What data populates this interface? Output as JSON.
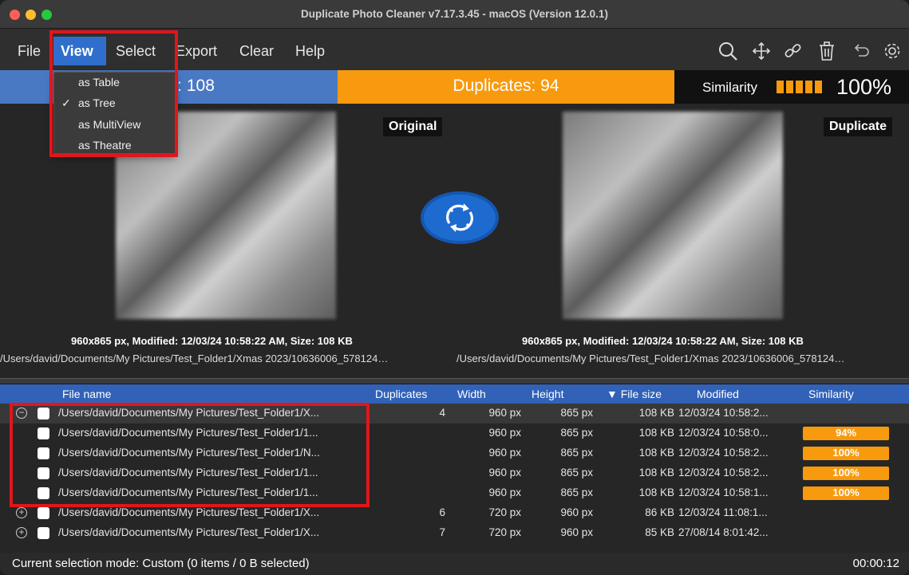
{
  "window": {
    "title": "Duplicate Photo Cleaner v7.17.3.45 - macOS (Version 12.0.1)"
  },
  "menubar": {
    "items": [
      "File",
      "View",
      "Select",
      "Export",
      "Clear",
      "Help"
    ],
    "toolbar_icons": [
      "search-icon",
      "move-icon",
      "link-icon",
      "trash-icon",
      "undo-icon",
      "gear-icon"
    ]
  },
  "view_menu": {
    "items": [
      {
        "label": "as Table",
        "checked": false
      },
      {
        "label": "as Tree",
        "checked": true
      },
      {
        "label": "as MultiView",
        "checked": false
      },
      {
        "label": "as Theatre",
        "checked": false
      }
    ]
  },
  "stats": {
    "files_label": "es: 108",
    "duplicates_label": "Duplicates: 94",
    "similarity_label": "Similarity",
    "similarity_value": "100%",
    "colors": {
      "files": "#4a79c4",
      "duplicates": "#f89a0e",
      "similarity_bg": "#111111"
    }
  },
  "compare": {
    "original_tag": "Original",
    "duplicate_tag": "Duplicate",
    "original_info": "960x865 px, Modified: 12/03/24 10:58:22 AM, Size: 108 KB",
    "duplicate_info": "960x865 px, Modified: 12/03/24 10:58:22 AM, Size: 108 KB",
    "original_path": "/Users/david/Documents/My Pictures/Test_Folder1/Xmas 2023/10636006_578124…",
    "duplicate_path": "/Users/david/Documents/My Pictures/Test_Folder1/Xmas 2023/10636006_578124…"
  },
  "table": {
    "columns": [
      "File name",
      "Duplicates",
      "Width",
      "Height",
      "▼ File size",
      "Modified",
      "Similarity"
    ],
    "rows": [
      {
        "expander": "⊖",
        "fname": "/Users/david/Documents/My Pictures/Test_Folder1/X...",
        "dups": "4",
        "width": "960 px",
        "height": "865 px",
        "fsize": "108 KB",
        "mod": "12/03/24 10:58:2...",
        "sim": ""
      },
      {
        "expander": "",
        "fname": "/Users/david/Documents/My Pictures/Test_Folder1/1...",
        "dups": "",
        "width": "960 px",
        "height": "865 px",
        "fsize": "108 KB",
        "mod": "12/03/24 10:58:0...",
        "sim": "94%"
      },
      {
        "expander": "",
        "fname": "/Users/david/Documents/My Pictures/Test_Folder1/N...",
        "dups": "",
        "width": "960 px",
        "height": "865 px",
        "fsize": "108 KB",
        "mod": "12/03/24 10:58:2...",
        "sim": "100%"
      },
      {
        "expander": "",
        "fname": "/Users/david/Documents/My Pictures/Test_Folder1/1...",
        "dups": "",
        "width": "960 px",
        "height": "865 px",
        "fsize": "108 KB",
        "mod": "12/03/24 10:58:2...",
        "sim": "100%"
      },
      {
        "expander": "",
        "fname": "/Users/david/Documents/My Pictures/Test_Folder1/1...",
        "dups": "",
        "width": "960 px",
        "height": "865 px",
        "fsize": "108 KB",
        "mod": "12/03/24 10:58:1...",
        "sim": "100%"
      },
      {
        "expander": "⊕",
        "fname": "/Users/david/Documents/My Pictures/Test_Folder1/X...",
        "dups": "6",
        "width": "720 px",
        "height": "960 px",
        "fsize": "86 KB",
        "mod": "12/03/24 11:08:1...",
        "sim": ""
      },
      {
        "expander": "⊕",
        "fname": "/Users/david/Documents/My Pictures/Test_Folder1/X...",
        "dups": "7",
        "width": "720 px",
        "height": "960 px",
        "fsize": "85 KB",
        "mod": "27/08/14 8:01:42...",
        "sim": ""
      }
    ]
  },
  "status": {
    "text": "Current selection mode: Custom (0 items / 0 B selected)",
    "timer": "00:00:12"
  }
}
